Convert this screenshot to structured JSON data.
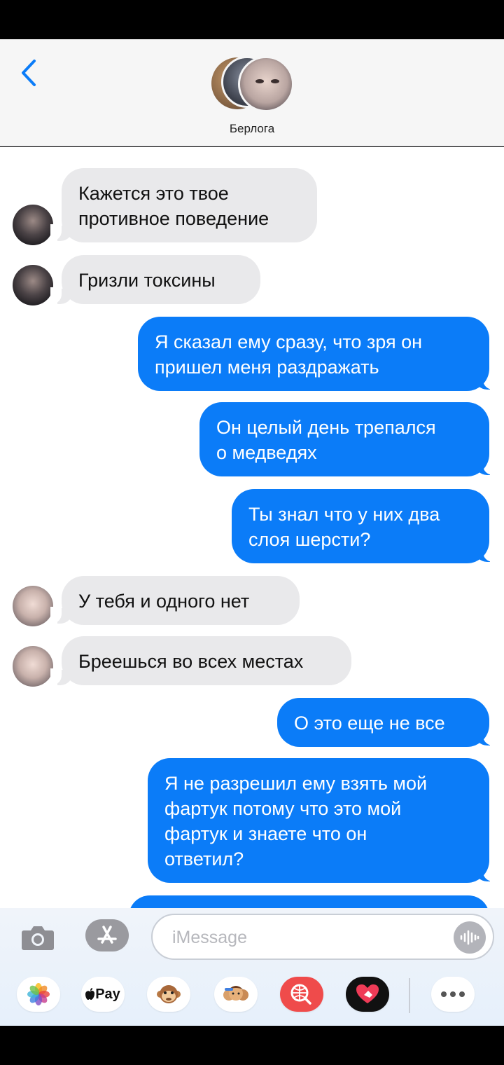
{
  "header": {
    "title": "Берлога"
  },
  "messages": [
    {
      "direction": "incoming",
      "text": "Кажется это твое\nпротивное поведение",
      "avatar": "dark"
    },
    {
      "direction": "incoming",
      "text": "Гризли токсины",
      "avatar": "dark"
    },
    {
      "direction": "outgoing",
      "text": "Я сказал ему сразу, что зря он\nпришел меня раздражать"
    },
    {
      "direction": "outgoing",
      "text": "Он целый день трепался\nо медведях"
    },
    {
      "direction": "outgoing",
      "text": "Ты знал что у них два\nслоя шерсти?"
    },
    {
      "direction": "incoming",
      "text": "У тебя и одного нет",
      "avatar": "light"
    },
    {
      "direction": "incoming",
      "text": "Бреешься во всех местах",
      "avatar": "light"
    },
    {
      "direction": "outgoing",
      "text": "О это еще не все"
    },
    {
      "direction": "outgoing",
      "text": "Я не разрешил ему взять мой\nфартук потому что это мой\nфартук и знаете что он\nответил?"
    }
  ],
  "composer": {
    "placeholder": "iMessage",
    "camera_icon": "camera-icon",
    "apps_icon": "app-store-icon",
    "audio_icon": "waveform-icon"
  },
  "app_drawer": [
    {
      "name": "photos-app",
      "icon": "photos-icon",
      "label": ""
    },
    {
      "name": "apple-pay-app",
      "icon": "apple-icon",
      "label": "Pay"
    },
    {
      "name": "animoji-app",
      "icon": "monkey-icon",
      "label": ""
    },
    {
      "name": "memoji-app",
      "icon": "memoji-icon",
      "label": ""
    },
    {
      "name": "images-search-app",
      "icon": "globe-search-icon",
      "label": ""
    },
    {
      "name": "digital-touch-app",
      "icon": "heart-touch-icon",
      "label": ""
    },
    {
      "name": "more-apps",
      "icon": "more-icon",
      "label": ""
    }
  ],
  "colors": {
    "outgoing_bubble": "#0b7cf8",
    "incoming_bubble": "#e9e9eb",
    "accent": "#0b7cf8"
  }
}
